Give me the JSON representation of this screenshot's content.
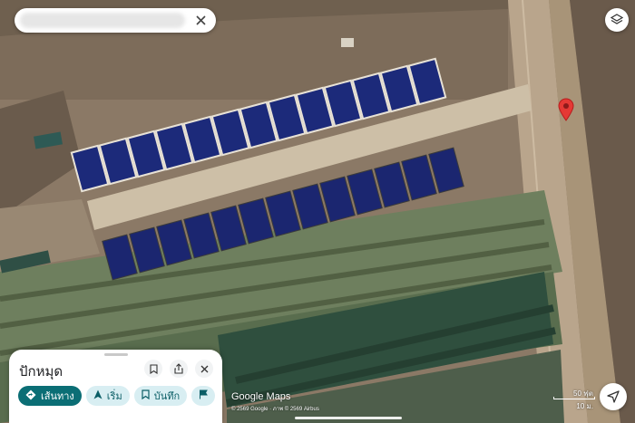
{
  "search": {
    "close_icon": "close-icon"
  },
  "map": {
    "layers_icon": "layers-icon",
    "pin_icon": "location-pin-icon",
    "pin_color": "#e53935"
  },
  "place_sheet": {
    "title": "ปักหมุด",
    "icons": [
      "bookmark-icon",
      "share-icon",
      "close-icon"
    ],
    "chips": [
      {
        "label": "เส้นทาง",
        "icon": "directions-icon",
        "style": "primary"
      },
      {
        "label": "เริ่ม",
        "icon": "navigate-arrow-icon",
        "style": "secondary"
      },
      {
        "label": "บันทึก",
        "icon": "bookmark-icon",
        "style": "secondary"
      },
      {
        "label": "",
        "icon": "flag-icon",
        "style": "secondary"
      }
    ]
  },
  "attribution": {
    "logo": "Google Maps",
    "copyright": "© 2569 Google · ภาพ © 2569 Airbus"
  },
  "scale": {
    "top": "50 ฟุต",
    "bottom": "10 ม."
  },
  "controls": {
    "locate_icon": "my-location-arrow-icon"
  },
  "colors": {
    "accent": "#0b6e75",
    "chip_bg": "#d8eef2"
  }
}
